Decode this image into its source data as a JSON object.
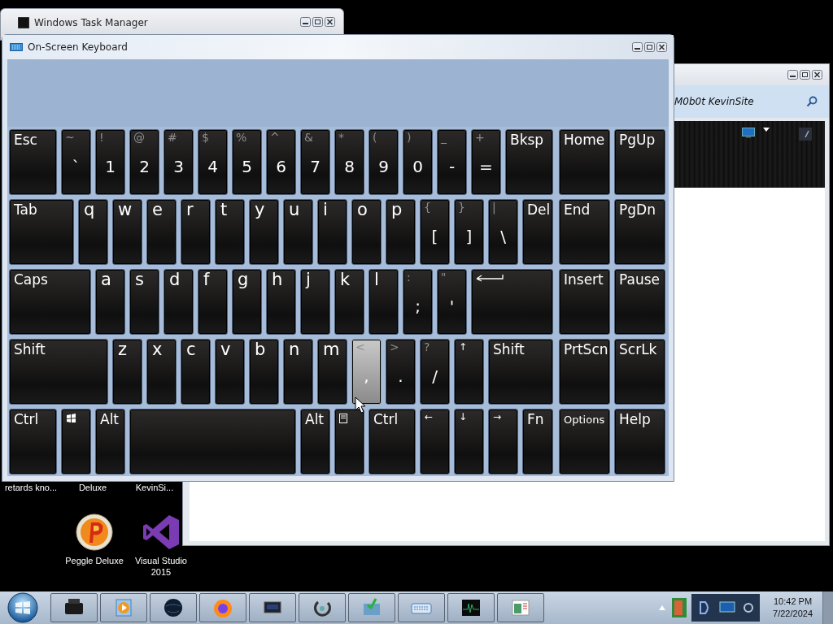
{
  "task_manager": {
    "title": "Windows Task Manager"
  },
  "browser_window": {
    "address": "M0b0t KevinSite"
  },
  "desktop": {
    "cut_labels": [
      "retards kno...",
      "Deluxe",
      "KevinSi..."
    ],
    "icons": [
      {
        "kind": "peggle",
        "label": "Peggle Deluxe"
      },
      {
        "kind": "visual-studio",
        "label": "Visual Studio 2015"
      }
    ]
  },
  "keyboard": {
    "title": "On-Screen Keyboard",
    "rows": [
      {
        "keys": [
          {
            "kind": "label",
            "label": "Esc",
            "pressed": false
          },
          {
            "kind": "dual",
            "shift": "~",
            "base": "`",
            "pressed": false
          },
          {
            "kind": "dual",
            "shift": "!",
            "base": "1",
            "pressed": false
          },
          {
            "kind": "dual",
            "shift": "@",
            "base": "2",
            "pressed": false
          },
          {
            "kind": "dual",
            "shift": "#",
            "base": "3",
            "pressed": false
          },
          {
            "kind": "dual",
            "shift": "$",
            "base": "4",
            "pressed": false
          },
          {
            "kind": "dual",
            "shift": "%",
            "base": "5",
            "pressed": false
          },
          {
            "kind": "dual",
            "shift": "^",
            "base": "6",
            "pressed": false
          },
          {
            "kind": "dual",
            "shift": "&",
            "base": "7",
            "pressed": false
          },
          {
            "kind": "dual",
            "shift": "*",
            "base": "8",
            "pressed": false
          },
          {
            "kind": "dual",
            "shift": "(",
            "base": "9",
            "pressed": false
          },
          {
            "kind": "dual",
            "shift": ")",
            "base": "0",
            "pressed": false
          },
          {
            "kind": "dual",
            "shift": "_",
            "base": "-",
            "pressed": false
          },
          {
            "kind": "dual",
            "shift": "+",
            "base": "=",
            "pressed": false
          },
          {
            "kind": "label",
            "label": "Bksp",
            "pressed": false
          }
        ]
      },
      {
        "keys": [
          {
            "kind": "label",
            "label": "Tab",
            "pressed": false
          },
          {
            "kind": "letter",
            "label": "q",
            "pressed": false
          },
          {
            "kind": "letter",
            "label": "w",
            "pressed": false
          },
          {
            "kind": "letter",
            "label": "e",
            "pressed": false
          },
          {
            "kind": "letter",
            "label": "r",
            "pressed": false
          },
          {
            "kind": "letter",
            "label": "t",
            "pressed": false
          },
          {
            "kind": "letter",
            "label": "y",
            "pressed": false
          },
          {
            "kind": "letter",
            "label": "u",
            "pressed": false
          },
          {
            "kind": "letter",
            "label": "i",
            "pressed": false
          },
          {
            "kind": "letter",
            "label": "o",
            "pressed": false
          },
          {
            "kind": "letter",
            "label": "p",
            "pressed": false
          },
          {
            "kind": "dual",
            "shift": "{",
            "base": "[",
            "pressed": false
          },
          {
            "kind": "dual",
            "shift": "}",
            "base": "]",
            "pressed": false
          },
          {
            "kind": "dual",
            "shift": "|",
            "base": "\\",
            "pressed": false
          },
          {
            "kind": "label",
            "label": "Del",
            "pressed": false
          }
        ]
      },
      {
        "keys": [
          {
            "kind": "label",
            "label": "Caps",
            "pressed": false
          },
          {
            "kind": "letter",
            "label": "a",
            "pressed": false
          },
          {
            "kind": "letter",
            "label": "s",
            "pressed": false
          },
          {
            "kind": "letter",
            "label": "d",
            "pressed": false
          },
          {
            "kind": "letter",
            "label": "f",
            "pressed": false
          },
          {
            "kind": "letter",
            "label": "g",
            "pressed": false
          },
          {
            "kind": "letter",
            "label": "h",
            "pressed": false
          },
          {
            "kind": "letter",
            "label": "j",
            "pressed": false
          },
          {
            "kind": "letter",
            "label": "k",
            "pressed": false
          },
          {
            "kind": "letter",
            "label": "l",
            "pressed": false
          },
          {
            "kind": "dual",
            "shift": ":",
            "base": ";",
            "pressed": false
          },
          {
            "kind": "dual",
            "shift": "\"",
            "base": "'",
            "pressed": false
          },
          {
            "kind": "enter",
            "pressed": false
          }
        ]
      },
      {
        "keys": [
          {
            "kind": "label",
            "label": "Shift",
            "pressed": false
          },
          {
            "kind": "letter",
            "label": "z",
            "pressed": false
          },
          {
            "kind": "letter",
            "label": "x",
            "pressed": false
          },
          {
            "kind": "letter",
            "label": "c",
            "pressed": false
          },
          {
            "kind": "letter",
            "label": "v",
            "pressed": false
          },
          {
            "kind": "letter",
            "label": "b",
            "pressed": false
          },
          {
            "kind": "letter",
            "label": "n",
            "pressed": false
          },
          {
            "kind": "letter",
            "label": "m",
            "pressed": false
          },
          {
            "kind": "dual",
            "shift": "<",
            "base": ",",
            "pressed": true
          },
          {
            "kind": "dual",
            "shift": ">",
            "base": ".",
            "pressed": false
          },
          {
            "kind": "dual",
            "shift": "?",
            "base": "/",
            "pressed": false
          },
          {
            "kind": "arrow",
            "label": "↑",
            "pressed": false
          },
          {
            "kind": "label",
            "label": "Shift",
            "pressed": false
          }
        ]
      },
      {
        "keys": [
          {
            "kind": "label",
            "label": "Ctrl",
            "pressed": false
          },
          {
            "kind": "win",
            "pressed": false
          },
          {
            "kind": "label",
            "label": "Alt",
            "pressed": false
          },
          {
            "kind": "space",
            "pressed": false
          },
          {
            "kind": "label",
            "label": "Alt",
            "pressed": false
          },
          {
            "kind": "menu",
            "pressed": false
          },
          {
            "kind": "label",
            "label": "Ctrl",
            "pressed": false
          },
          {
            "kind": "arrow",
            "label": "←",
            "pressed": false
          },
          {
            "kind": "arrow",
            "label": "↓",
            "pressed": false
          },
          {
            "kind": "arrow",
            "label": "→",
            "pressed": false
          },
          {
            "kind": "label",
            "label": "Fn",
            "pressed": false
          }
        ]
      }
    ],
    "nav_rows": [
      {
        "keys": [
          {
            "kind": "label",
            "label": "Home",
            "pressed": false
          },
          {
            "kind": "label",
            "label": "PgUp",
            "pressed": false
          }
        ]
      },
      {
        "keys": [
          {
            "kind": "label",
            "label": "End",
            "pressed": false
          },
          {
            "kind": "label",
            "label": "PgDn",
            "pressed": false
          }
        ]
      },
      {
        "keys": [
          {
            "kind": "label",
            "label": "Insert",
            "pressed": false
          },
          {
            "kind": "label",
            "label": "Pause",
            "pressed": false
          }
        ]
      },
      {
        "keys": [
          {
            "kind": "label",
            "label": "PrtScn",
            "pressed": false
          },
          {
            "kind": "label",
            "label": "ScrLk",
            "pressed": false
          }
        ]
      },
      {
        "keys": [
          {
            "kind": "label-small",
            "label": "Options",
            "pressed": false
          },
          {
            "kind": "label",
            "label": "Help",
            "pressed": false
          }
        ]
      }
    ]
  },
  "taskbar": {
    "time": "10:42 PM",
    "date": "7/22/2024"
  }
}
